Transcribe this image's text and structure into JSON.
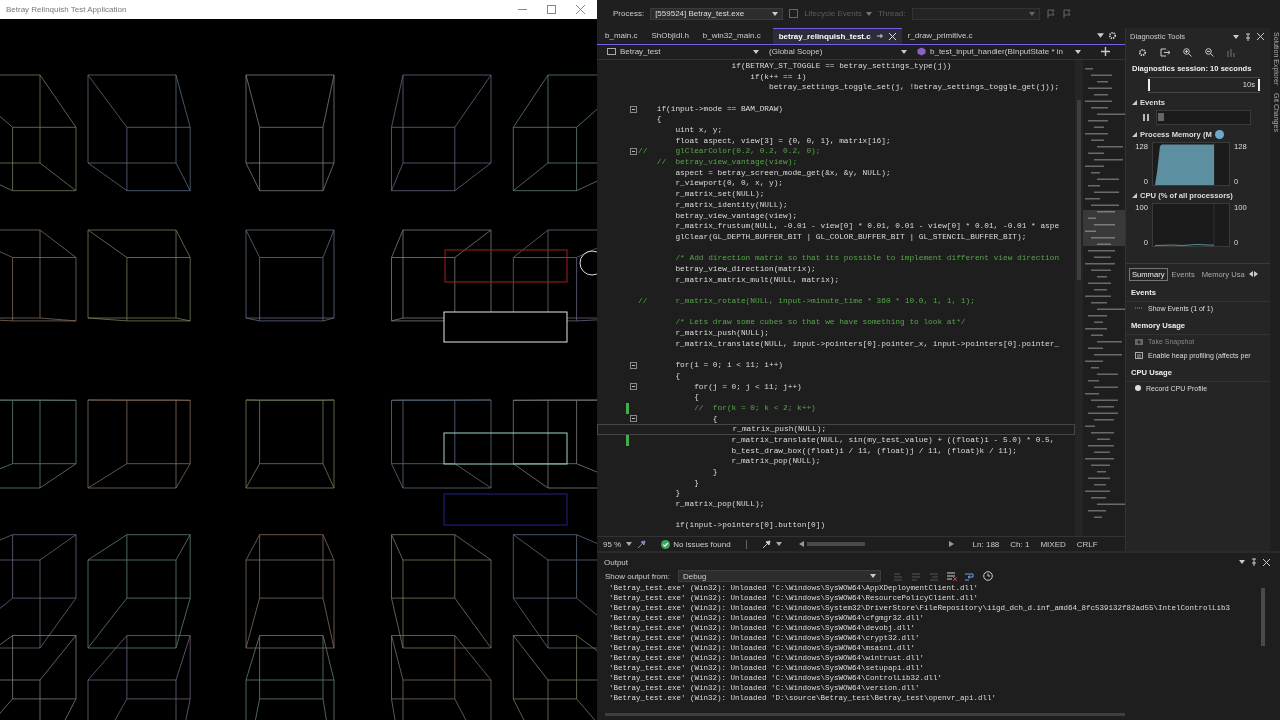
{
  "app_window": {
    "title": "Betray Relinquish Test Application"
  },
  "process_bar": {
    "process_label": "Process:",
    "process": "[559524] Betray_test.exe",
    "lifecycle": {
      "label": "Lifecycle Events",
      "disabled": true
    },
    "thread": {
      "label": "Thread:",
      "disabled": true
    }
  },
  "editor_tabs": [
    {
      "label": "b_main.c",
      "selected": false
    },
    {
      "label": "ShObjIdl.h",
      "selected": false
    },
    {
      "label": "b_win32_main.c",
      "selected": false
    },
    {
      "label": "betray_relinquish_test.c",
      "selected": true
    },
    {
      "label": "r_draw_primitive.c",
      "selected": false
    }
  ],
  "nav_bar": {
    "project": "Betray_test",
    "scope": "(Global Scope)",
    "member": "b_test_input_handler(BInputState * in"
  },
  "code_lines": [
    {
      "text": "                    if(BETRAY_ST_TOGGLE == betray_settings_type(j))",
      "kind": "code",
      "fold": false,
      "changed": false,
      "current": false
    },
    {
      "text": "                        if(k++ == i)",
      "kind": "code",
      "fold": false,
      "changed": false,
      "current": false
    },
    {
      "text": "                            betray_settings_toggle_set(j, !betray_settings_toggle_get(j));",
      "kind": "code",
      "fold": false,
      "changed": false,
      "current": false
    },
    {
      "kind": "blank",
      "fold": false,
      "changed": false,
      "current": false
    },
    {
      "text": "    if(input->mode == BAM_DRAW)",
      "kind": "code",
      "fold": true,
      "changed": false,
      "current": false
    },
    {
      "text": "    {",
      "kind": "code",
      "fold": false,
      "changed": false,
      "current": false
    },
    {
      "text": "        uint x, y;",
      "kind": "code",
      "fold": false,
      "changed": false,
      "current": false
    },
    {
      "text": "        float aspect, view[3] = {0, 0, 1}, matrix[16];",
      "kind": "code",
      "fold": false,
      "changed": false,
      "current": false
    },
    {
      "text": "//      glClearColor(0.2, 0.2, 0.2, 0);",
      "kind": "comment",
      "fold": true,
      "changed": false,
      "current": false
    },
    {
      "text": "    //  betray_view_vantage(view);",
      "kind": "comment",
      "fold": false,
      "changed": false,
      "current": false
    },
    {
      "text": "        aspect = betray_screen_mode_get(&x, &y, NULL);",
      "kind": "code",
      "fold": false,
      "changed": false,
      "current": false
    },
    {
      "text": "        r_viewport(0, 0, x, y);",
      "kind": "code",
      "fold": false,
      "changed": false,
      "current": false
    },
    {
      "text": "        r_matrix_set(NULL);",
      "kind": "code",
      "fold": false,
      "changed": false,
      "current": false
    },
    {
      "text": "        r_matrix_identity(NULL);",
      "kind": "code",
      "fold": false,
      "changed": false,
      "current": false
    },
    {
      "text": "        betray_view_vantage(view);",
      "kind": "code",
      "fold": false,
      "changed": false,
      "current": false
    },
    {
      "text": "        r_matrix_frustum(NULL, -0.01 - view[0] * 0.01, 0.01 - view[0] * 0.01, -0.01 * aspe",
      "kind": "code",
      "fold": false,
      "changed": false,
      "current": false
    },
    {
      "text": "        glClear(GL_DEPTH_BUFFER_BIT | GL_COLOR_BUFFER_BIT | GL_STENCIL_BUFFER_BIT);",
      "kind": "code",
      "fold": false,
      "changed": false,
      "current": false
    },
    {
      "kind": "blank",
      "fold": false,
      "changed": false,
      "current": false
    },
    {
      "text": "        /* Add direction matrix so that its possible to implement different view direction",
      "kind": "comment",
      "fold": false,
      "changed": false,
      "current": false
    },
    {
      "text": "        betray_view_direction(matrix);",
      "kind": "code",
      "fold": false,
      "changed": false,
      "current": false
    },
    {
      "text": "        r_matrix_matrix_mult(NULL, matrix);",
      "kind": "code",
      "fold": false,
      "changed": false,
      "current": false
    },
    {
      "kind": "blank",
      "fold": false,
      "changed": false,
      "current": false
    },
    {
      "text": "//      r_matrix_rotate(NULL, input->minute_time * 360 * 10.0, 1, 1, 1);",
      "kind": "comment",
      "fold": false,
      "changed": false,
      "current": false
    },
    {
      "kind": "blank",
      "fold": false,
      "changed": false,
      "current": false
    },
    {
      "text": "        /* Lets draw some cubes so that we have something to look at*/",
      "kind": "comment",
      "fold": false,
      "changed": false,
      "current": false
    },
    {
      "text": "        r_matrix_push(NULL);",
      "kind": "code",
      "fold": false,
      "changed": false,
      "current": false
    },
    {
      "text": "        r_matrix_translate(NULL, input->pointers[0].pointer_x, input->pointers[0].pointer_",
      "kind": "code",
      "fold": false,
      "changed": false,
      "current": false
    },
    {
      "kind": "blank",
      "fold": false,
      "changed": false,
      "current": false
    },
    {
      "text": "        for(i = 0; i < 11; i++)",
      "kind": "code",
      "fold": true,
      "changed": false,
      "current": false
    },
    {
      "text": "        {",
      "kind": "code",
      "fold": false,
      "changed": false,
      "current": false
    },
    {
      "text": "            for(j = 0; j < 11; j++)",
      "kind": "code",
      "fold": true,
      "changed": false,
      "current": false
    },
    {
      "text": "            {",
      "kind": "code",
      "fold": false,
      "changed": false,
      "current": false
    },
    {
      "text": "            //  for(k = 0; k < 2; k++)",
      "kind": "comment",
      "fold": false,
      "changed": true,
      "current": false
    },
    {
      "text": "                {",
      "kind": "code",
      "fold": true,
      "changed": false,
      "current": false
    },
    {
      "text": "                    r_matrix_push(NULL);",
      "kind": "code",
      "fold": false,
      "changed": false,
      "current": true
    },
    {
      "text": "                    r_matrix_translate(NULL, sin(my_test_value) + ((float)i - 5.0) * 0.5,",
      "kind": "code",
      "fold": false,
      "changed": true,
      "current": false
    },
    {
      "text": "                    b_test_draw_box((float)i / 11, (float)j / 11, (float)k / 11);",
      "kind": "code",
      "fold": false,
      "changed": false,
      "current": false
    },
    {
      "text": "                    r_matrix_pop(NULL);",
      "kind": "code",
      "fold": false,
      "changed": false,
      "current": false
    },
    {
      "text": "                }",
      "kind": "code",
      "fold": false,
      "changed": false,
      "current": false
    },
    {
      "text": "            }",
      "kind": "code",
      "fold": false,
      "changed": false,
      "current": false
    },
    {
      "text": "        }",
      "kind": "code",
      "fold": false,
      "changed": false,
      "current": false
    },
    {
      "text": "        r_matrix_pop(NULL);",
      "kind": "code",
      "fold": false,
      "changed": false,
      "current": false
    },
    {
      "kind": "blank",
      "fold": false,
      "changed": false,
      "current": false
    },
    {
      "text": "        if(input->pointers[0].button[0])",
      "kind": "code",
      "fold": false,
      "changed": false,
      "current": false
    }
  ],
  "status_bar": {
    "zoom": "95 %",
    "issues": "No issues found",
    "line": "Ln: 188",
    "column": "Ch: 1",
    "whitespace": "MIXED",
    "line_ending": "CRLF"
  },
  "diagnostics": {
    "title": "Diagnostic Tools",
    "session": "Diagnostics session: 10 seconds",
    "timeline_label": "10s",
    "events_title": "Events",
    "memory": {
      "title": "Process Memory (M",
      "left_ticks": [
        "128",
        "0"
      ],
      "right_ticks": [
        "128",
        "0"
      ]
    },
    "cpu": {
      "title": "CPU (% of all processors)",
      "left_ticks": [
        "100",
        "0"
      ],
      "right_ticks": [
        "100",
        "0"
      ]
    },
    "tabs": [
      {
        "label": "Summary",
        "selected": true
      },
      {
        "label": "Events",
        "selected": false
      },
      {
        "label": "Memory Usa",
        "selected": false
      }
    ],
    "sections": [
      {
        "title": "Events",
        "items": [
          {
            "label": "Show Events (1 of 1)",
            "kind": "events",
            "disabled": false
          }
        ]
      },
      {
        "title": "Memory Usage",
        "items": [
          {
            "label": "Take Snapshot",
            "kind": "snapshot",
            "disabled": true
          },
          {
            "label": "Enable heap profiling (affects per",
            "kind": "heap",
            "disabled": false
          }
        ]
      },
      {
        "title": "CPU Usage",
        "items": [
          {
            "label": "Record CPU Profile",
            "kind": "record",
            "disabled": false
          }
        ]
      }
    ]
  },
  "side_tabs": [
    "Solution Explorer",
    "Git Changes"
  ],
  "output": {
    "title": "Output",
    "source_label": "Show output from:",
    "source": "Debug",
    "lines": [
      "'Betray_test.exe' (Win32): Unloaded 'C:\\Windows\\SysWOW64\\AppXDeploymentClient.dll'",
      "'Betray_test.exe' (Win32): Unloaded 'C:\\Windows\\SysWOW64\\ResourcePolicyClient.dll'",
      "'Betray_test.exe' (Win32): Unloaded 'C:\\Windows\\System32\\DriverStore\\FileRepository\\iigd_dch_d.inf_amd64_8fc539132f82ad55\\IntelControlLib3",
      "'Betray_test.exe' (Win32): Unloaded 'C:\\Windows\\SysWOW64\\cfgmgr32.dll'",
      "'Betray_test.exe' (Win32): Unloaded 'C:\\Windows\\SysWOW64\\devobj.dll'",
      "'Betray_test.exe' (Win32): Unloaded 'C:\\Windows\\SysWOW64\\crypt32.dll'",
      "'Betray_test.exe' (Win32): Unloaded 'C:\\Windows\\SysWOW64\\msasn1.dll'",
      "'Betray_test.exe' (Win32): Unloaded 'C:\\Windows\\SysWOW64\\wintrust.dll'",
      "'Betray_test.exe' (Win32): Unloaded 'C:\\Windows\\SysWOW64\\setupapi.dll'",
      "'Betray_test.exe' (Win32): Unloaded 'C:\\Windows\\SysWOW64\\ControlLib32.dll'",
      "'Betray_test.exe' (Win32): Unloaded 'C:\\Windows\\SysWOW64\\version.dll'",
      "'Betray_test.exe' (Win32): Unloaded 'D:\\source\\Betray_test\\Betray_test\\openvr_api.dll'"
    ]
  }
}
